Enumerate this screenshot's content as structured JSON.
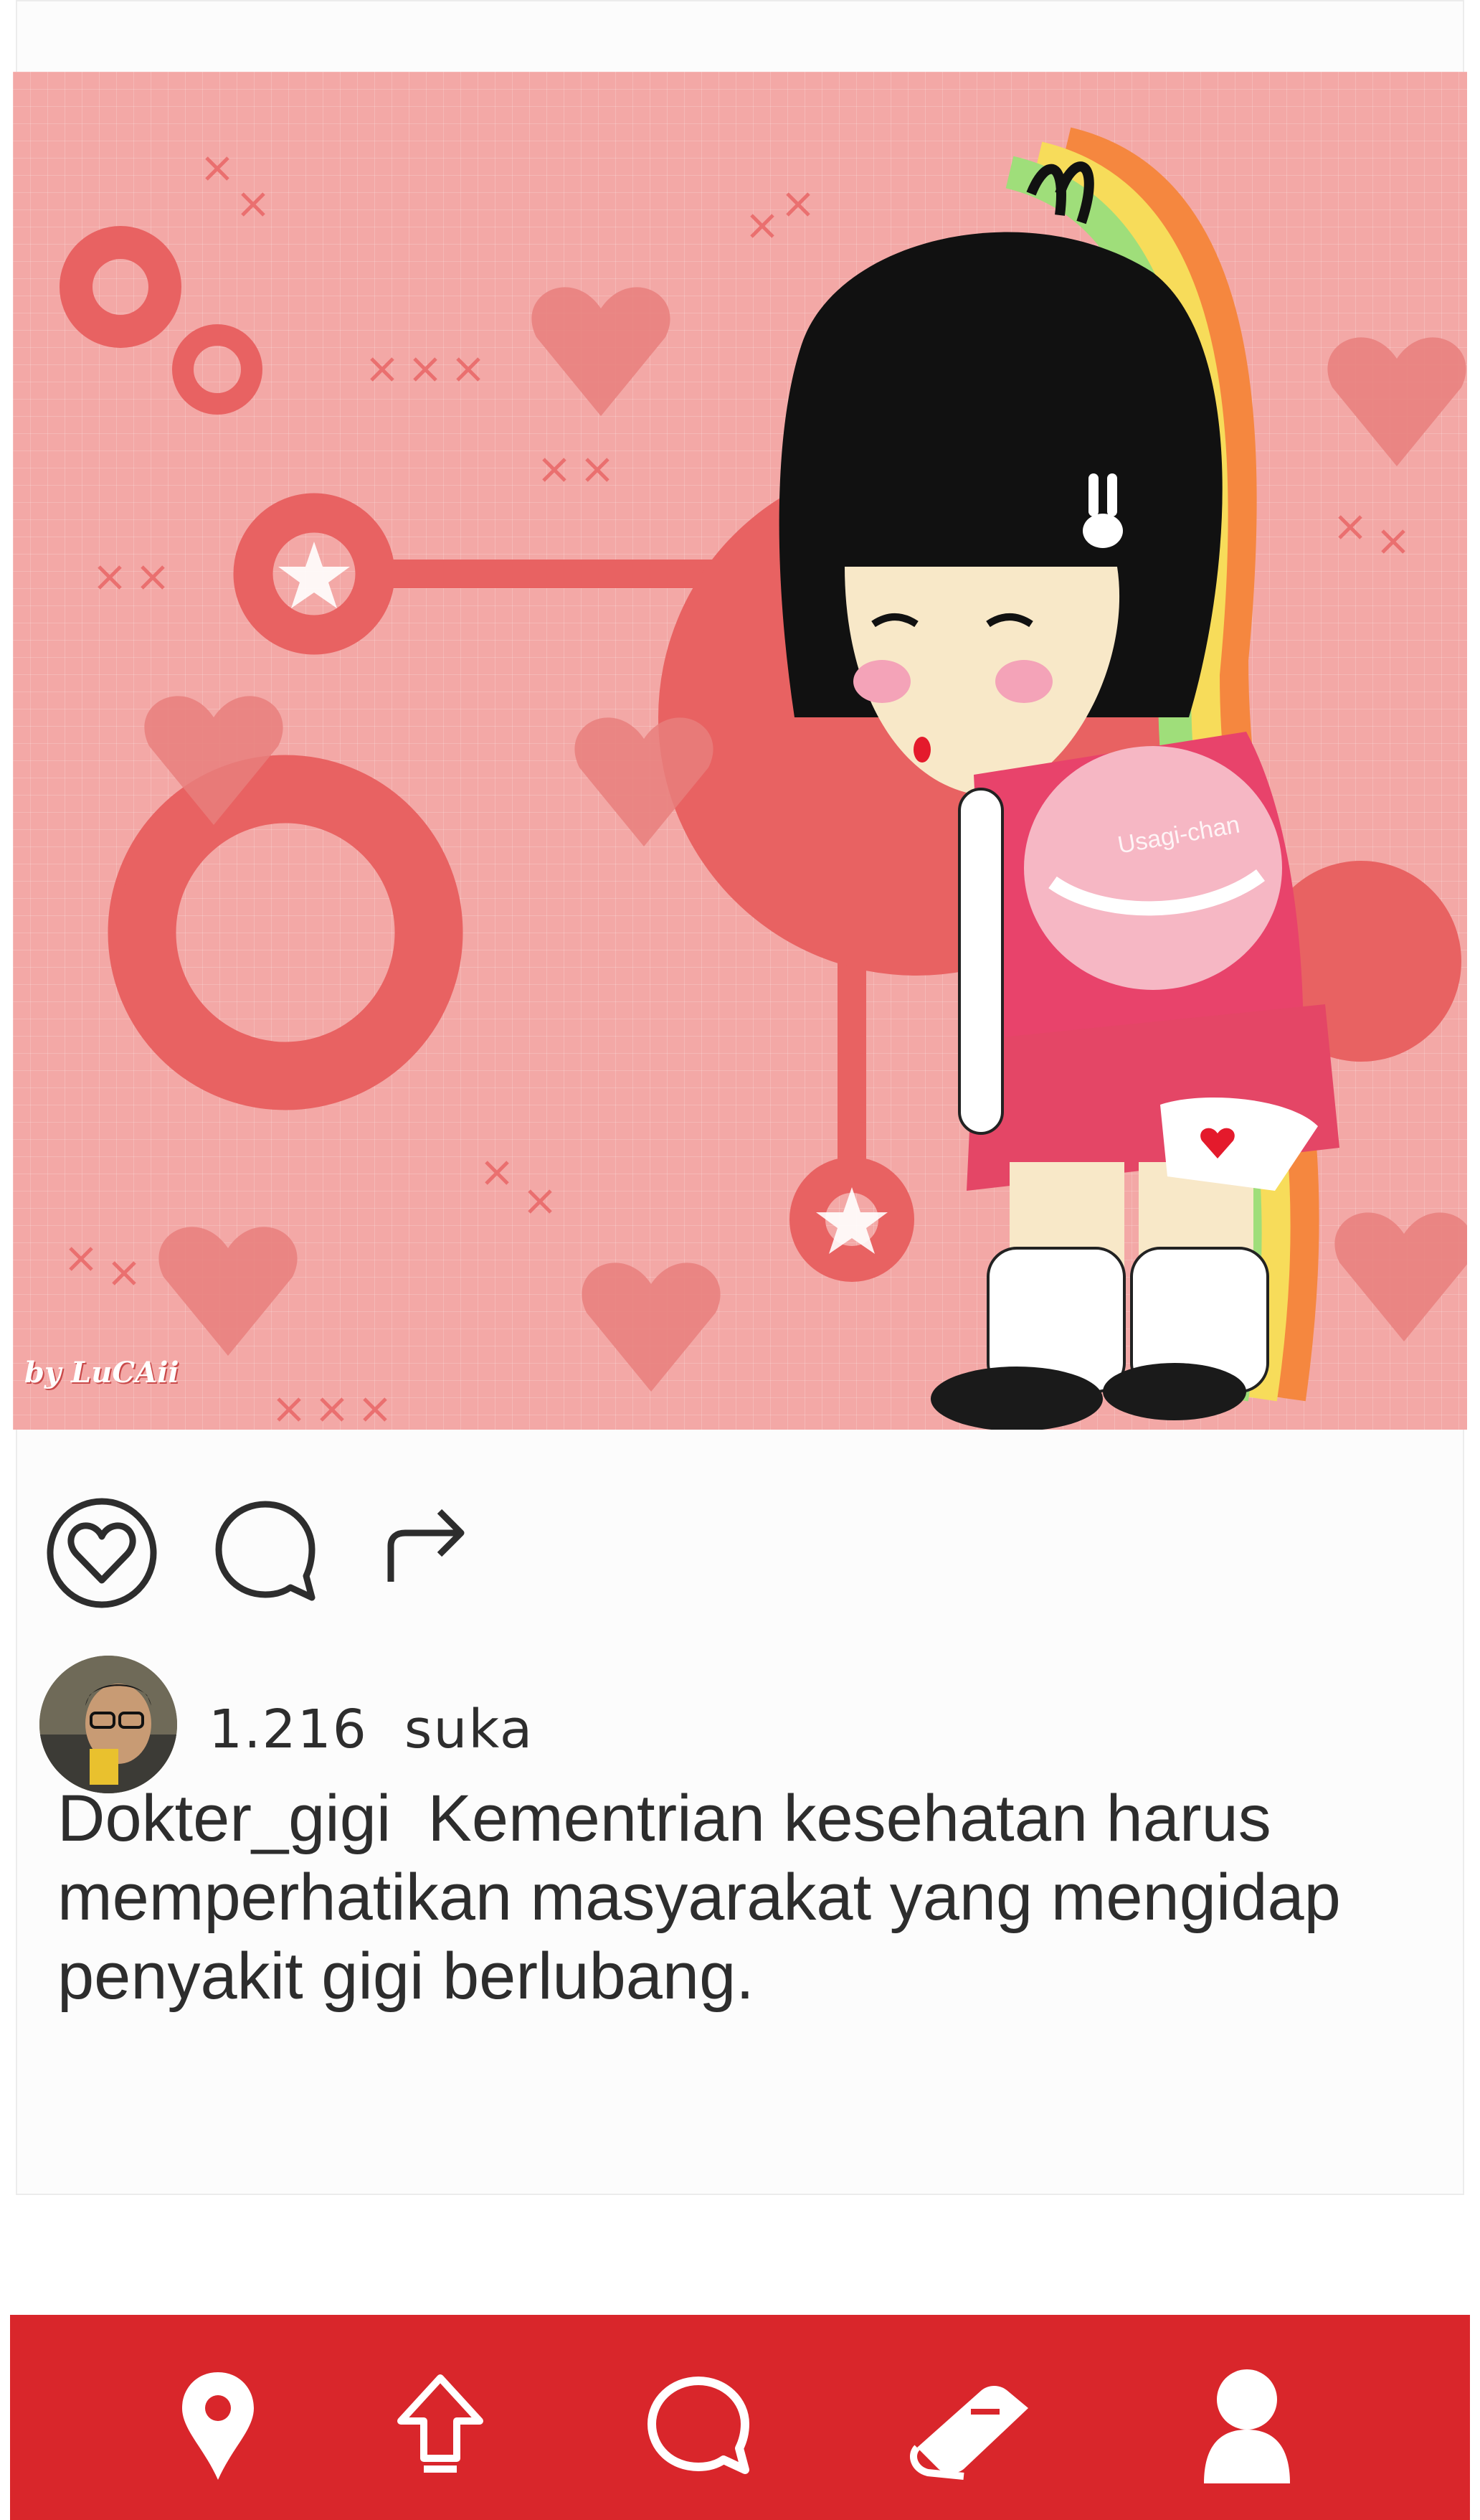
{
  "post": {
    "signature": "by LuCAii",
    "bag_label": "Usagi-chan"
  },
  "actions": {
    "like": "heart-icon",
    "comment": "comment-icon",
    "share": "share-arrow-icon"
  },
  "meta": {
    "likes_count": "1.216",
    "likes_word": "suka"
  },
  "caption": {
    "username": "Dokter_gigi",
    "text": "Kementrian kesehatan harus memperhatikan masyarakat yang mengidap penyakit gigi berlubang."
  },
  "bottom_nav": {
    "items": [
      "location-pin-icon",
      "upload-icon",
      "chat-icon",
      "book-icon",
      "profile-icon"
    ]
  },
  "colors": {
    "nav_bg": "#d9262b",
    "image_bg": "#f3a8a6",
    "accent_shape": "#e86262"
  }
}
